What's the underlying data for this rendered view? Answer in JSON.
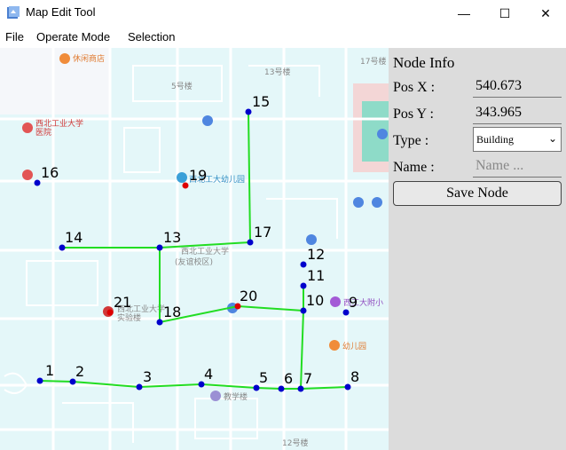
{
  "window": {
    "title": "Map Edit Tool",
    "minimize_glyph": "—",
    "maximize_glyph": "☐",
    "close_glyph": "✕"
  },
  "menu": {
    "items": [
      "File",
      "Operate Mode",
      "Selection"
    ]
  },
  "map": {
    "labels": {
      "building_13": "西北工业大学",
      "campus_13": "(友谊校区)",
      "hospital": "西北工业大学",
      "hospital2": "医院",
      "kindergarten": "西北工大幼儿园",
      "building_21a": "西北工业大学",
      "building_21b": "实验楼",
      "school_9": "西工大附小",
      "school_7": "幼儿园",
      "building_4": "教学楼",
      "library": "图书馆",
      "b17": "17号楼",
      "b12": "12号楼",
      "b5": "5号楼",
      "b13": "13号楼",
      "top_shop": "休闲商店"
    },
    "nodes": [
      {
        "id": "1"
      },
      {
        "id": "2"
      },
      {
        "id": "3"
      },
      {
        "id": "4"
      },
      {
        "id": "5"
      },
      {
        "id": "6"
      },
      {
        "id": "7"
      },
      {
        "id": "8"
      },
      {
        "id": "9"
      },
      {
        "id": "10"
      },
      {
        "id": "11"
      },
      {
        "id": "12"
      },
      {
        "id": "13"
      },
      {
        "id": "14"
      },
      {
        "id": "15"
      },
      {
        "id": "16"
      },
      {
        "id": "17"
      },
      {
        "id": "18"
      },
      {
        "id": "19"
      },
      {
        "id": "20"
      },
      {
        "id": "21"
      }
    ],
    "edges": [
      [
        "1",
        "2"
      ],
      [
        "2",
        "3"
      ],
      [
        "3",
        "4"
      ],
      [
        "4",
        "5"
      ],
      [
        "5",
        "6"
      ],
      [
        "6",
        "7"
      ],
      [
        "7",
        "8"
      ],
      [
        "7",
        "10"
      ],
      [
        "10",
        "11"
      ],
      [
        "10",
        "20"
      ],
      [
        "20",
        "18"
      ],
      [
        "18",
        "13"
      ],
      [
        "13",
        "14"
      ],
      [
        "13",
        "17"
      ],
      [
        "17",
        "15"
      ]
    ],
    "colors": {
      "node": "#0000cc",
      "poi_node": "#dd0000",
      "edge": "#22dd22",
      "water": "#e4f7f9",
      "road": "#ffffff"
    }
  },
  "panel": {
    "heading": "Node Info",
    "pos_x_label": "Pos X :",
    "pos_x_value": "540.673",
    "pos_y_label": "Pos Y :",
    "pos_y_value": "343.965",
    "type_label": "Type :",
    "type_value": "Building",
    "name_label": "Name :",
    "name_placeholder": "Name ...",
    "save_label": "Save Node"
  }
}
